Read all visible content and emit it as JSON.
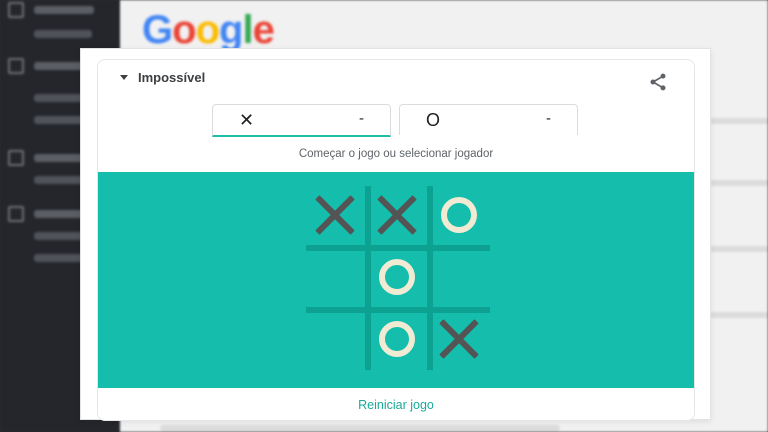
{
  "background": {
    "logo_text": "Google",
    "logo_colors": [
      "#4285F4",
      "#EA4335",
      "#FBBC05",
      "#4285F4",
      "#34A853",
      "#EA4335"
    ]
  },
  "game": {
    "difficulty": "Impossível",
    "share_icon": "share-icon",
    "players": [
      {
        "symbol": "✕",
        "score": "-",
        "active": true
      },
      {
        "symbol": "O",
        "score": "-",
        "active": false
      }
    ],
    "status": "Começar o jogo ou selecionar jogador",
    "board": [
      [
        "X",
        "X",
        "O"
      ],
      [
        "",
        "O",
        ""
      ],
      [
        "",
        "O",
        "X"
      ]
    ],
    "restart_label": "Reiniciar jogo",
    "colors": {
      "board": "#14bdac",
      "grid_line": "#0da192",
      "x_mark": "#545454",
      "o_mark": "#f2ebd3",
      "accent": "#1dbfaa"
    }
  }
}
